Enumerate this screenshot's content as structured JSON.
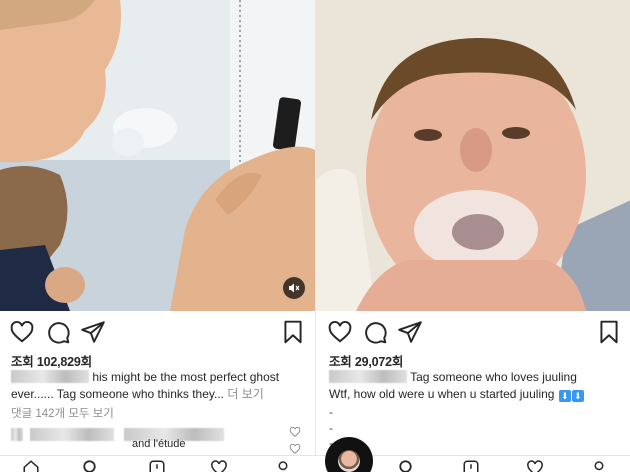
{
  "posts": [
    {
      "views_label": "조회 102,829회",
      "caption_lines": [
        "his might be the most perfect ghost",
        "ever...... Tag someone who thinks they..."
      ],
      "more_label": "더 보기",
      "comments_label": "댓글 142개 모두 보기",
      "comment_partial": "and l'étude"
    },
    {
      "views_label": "조회 29,072회",
      "caption_lines": [
        "Tag someone who loves juuling",
        "Wtf, how old were u when u started juuling"
      ],
      "dashes": [
        "-",
        "-",
        "-"
      ]
    }
  ],
  "colors": {
    "text": "#262626",
    "muted": "#8e8e8e",
    "link": "#3897f0"
  },
  "icons": [
    "heart-icon",
    "comment-icon",
    "share-icon",
    "bookmark-icon",
    "mute-icon",
    "home-icon",
    "search-icon",
    "reels-icon",
    "activity-icon",
    "profile-icon"
  ]
}
